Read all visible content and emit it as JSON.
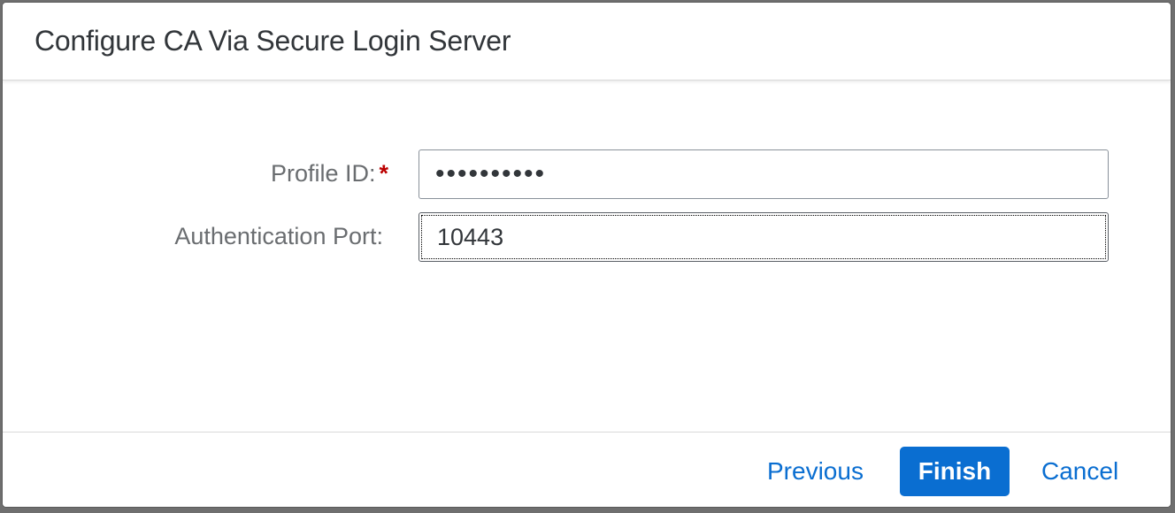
{
  "dialog": {
    "title": "Configure CA Via Secure Login Server"
  },
  "form": {
    "profile_id": {
      "label": "Profile ID:",
      "required_marker": "*",
      "masked_value": "••••••••••"
    },
    "authentication_port": {
      "label": "Authentication Port:",
      "value": "10443"
    }
  },
  "footer": {
    "previous_label": "Previous",
    "finish_label": "Finish",
    "cancel_label": "Cancel"
  },
  "colors": {
    "accent": "#0a6ed1",
    "required": "#bb0000",
    "label_text": "#6a6d70",
    "title_text": "#32363a"
  }
}
